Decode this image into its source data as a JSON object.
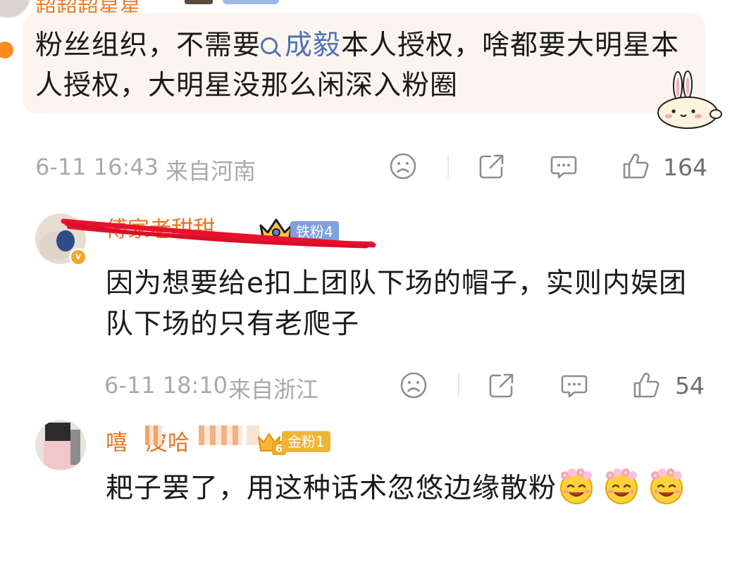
{
  "comment_top": {
    "username": "超超超星星",
    "text_before": "粉丝组织，不需要",
    "topic": "成毅",
    "text_after": "本人授权，啥都要大明星本人授权，大明星没那么闲深入粉圈",
    "time": "6-11 16:43",
    "location": "来自河南",
    "likes": "164"
  },
  "comment_2": {
    "username": "傅家老甜甜",
    "fan_badge": "铁粉4",
    "vip_badge": "v",
    "text": "因为想要给e扣上团队下场的帽子，实则内娱团队下场的只有老爬子",
    "time": "6-11 18:10",
    "location": "来自浙江",
    "likes": "54"
  },
  "comment_3": {
    "username_fragment_1": "嘻",
    "username_fragment_2": "皮",
    "username_fragment_3": "哈",
    "gold_level": "6",
    "fan_badge": "金粉1",
    "text": "耙子罢了，用这种话术忽悠边缘散粉"
  },
  "icons": [
    "dislike-face-icon",
    "share-icon",
    "comment-icon",
    "like-thumb-icon"
  ],
  "colors": {
    "username": "#e9741f",
    "topic_link": "#4f72b8",
    "meta_gray": "#a9a9a9",
    "bubble_bg": "#fbf5ef",
    "iron_fan_badge": "#7fa1dd",
    "gold_fan_badge": "#f0b534",
    "scribble_red": "#e8112d"
  }
}
